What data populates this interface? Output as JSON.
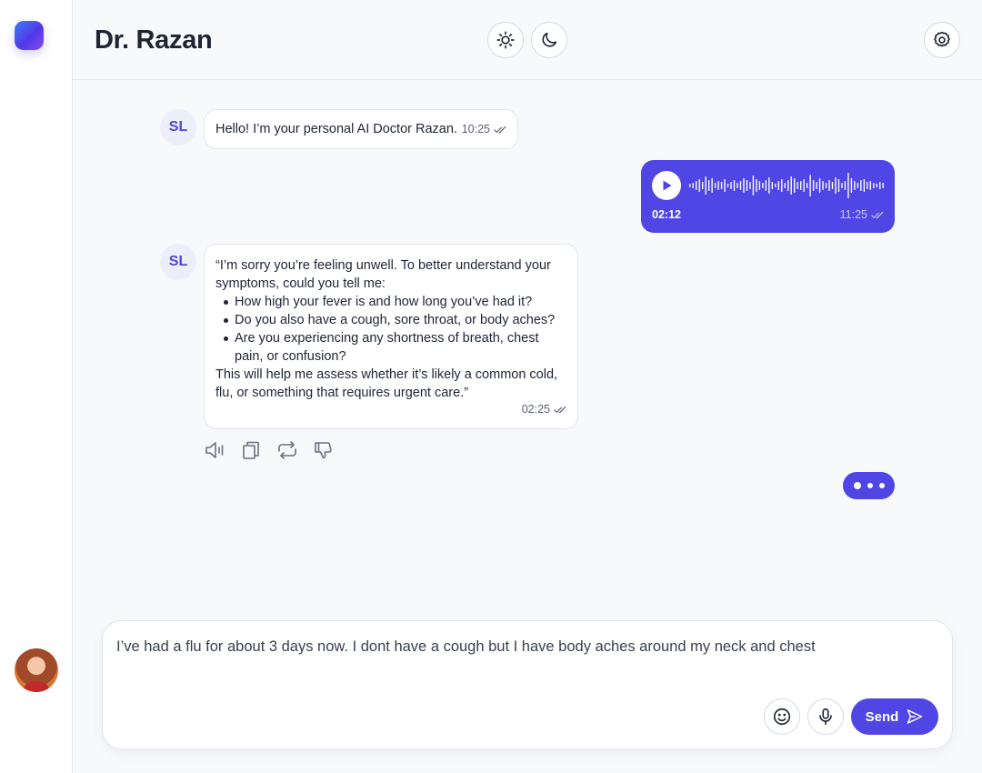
{
  "header": {
    "title": "Dr. Razan",
    "light_mode_icon": "sun-icon",
    "dark_mode_icon": "moon-icon",
    "settings_icon": "gear-icon"
  },
  "colors": {
    "accent": "#4f46e5",
    "avatar_bg": "#eceefa",
    "border": "#e2e5ec"
  },
  "messages": [
    {
      "sender": "SL",
      "text": "Hello! I’m your personal AI Doctor Razan.",
      "time": "10:25"
    },
    {
      "sender": "user",
      "type": "voice",
      "duration": "02:12",
      "time": "11:25"
    },
    {
      "sender": "SL",
      "intro": "“I’m sorry you’re feeling unwell. To better understand your symptoms, could you tell me:",
      "bullets": [
        "How high your fever is and how long you’ve had it?",
        "Do you also have a cough, sore throat, or body aches?",
        "Are you experiencing any shortness of breath, chest pain, or confusion?"
      ],
      "outro": "This will help me assess whether it’s likely a common cold, flu, or something that requires urgent care.”",
      "time": "02:25"
    }
  ],
  "message_actions": [
    "speaker-icon",
    "copy-icon",
    "regenerate-icon",
    "thumbs-down-icon"
  ],
  "composer": {
    "text": "I’ve had a flu for about 3 days now. I dont have a cough but I have body aches around my neck and chest",
    "emoji_icon": "smile-icon",
    "mic_icon": "microphone-icon",
    "send_label": "Send",
    "send_icon": "send-icon"
  }
}
